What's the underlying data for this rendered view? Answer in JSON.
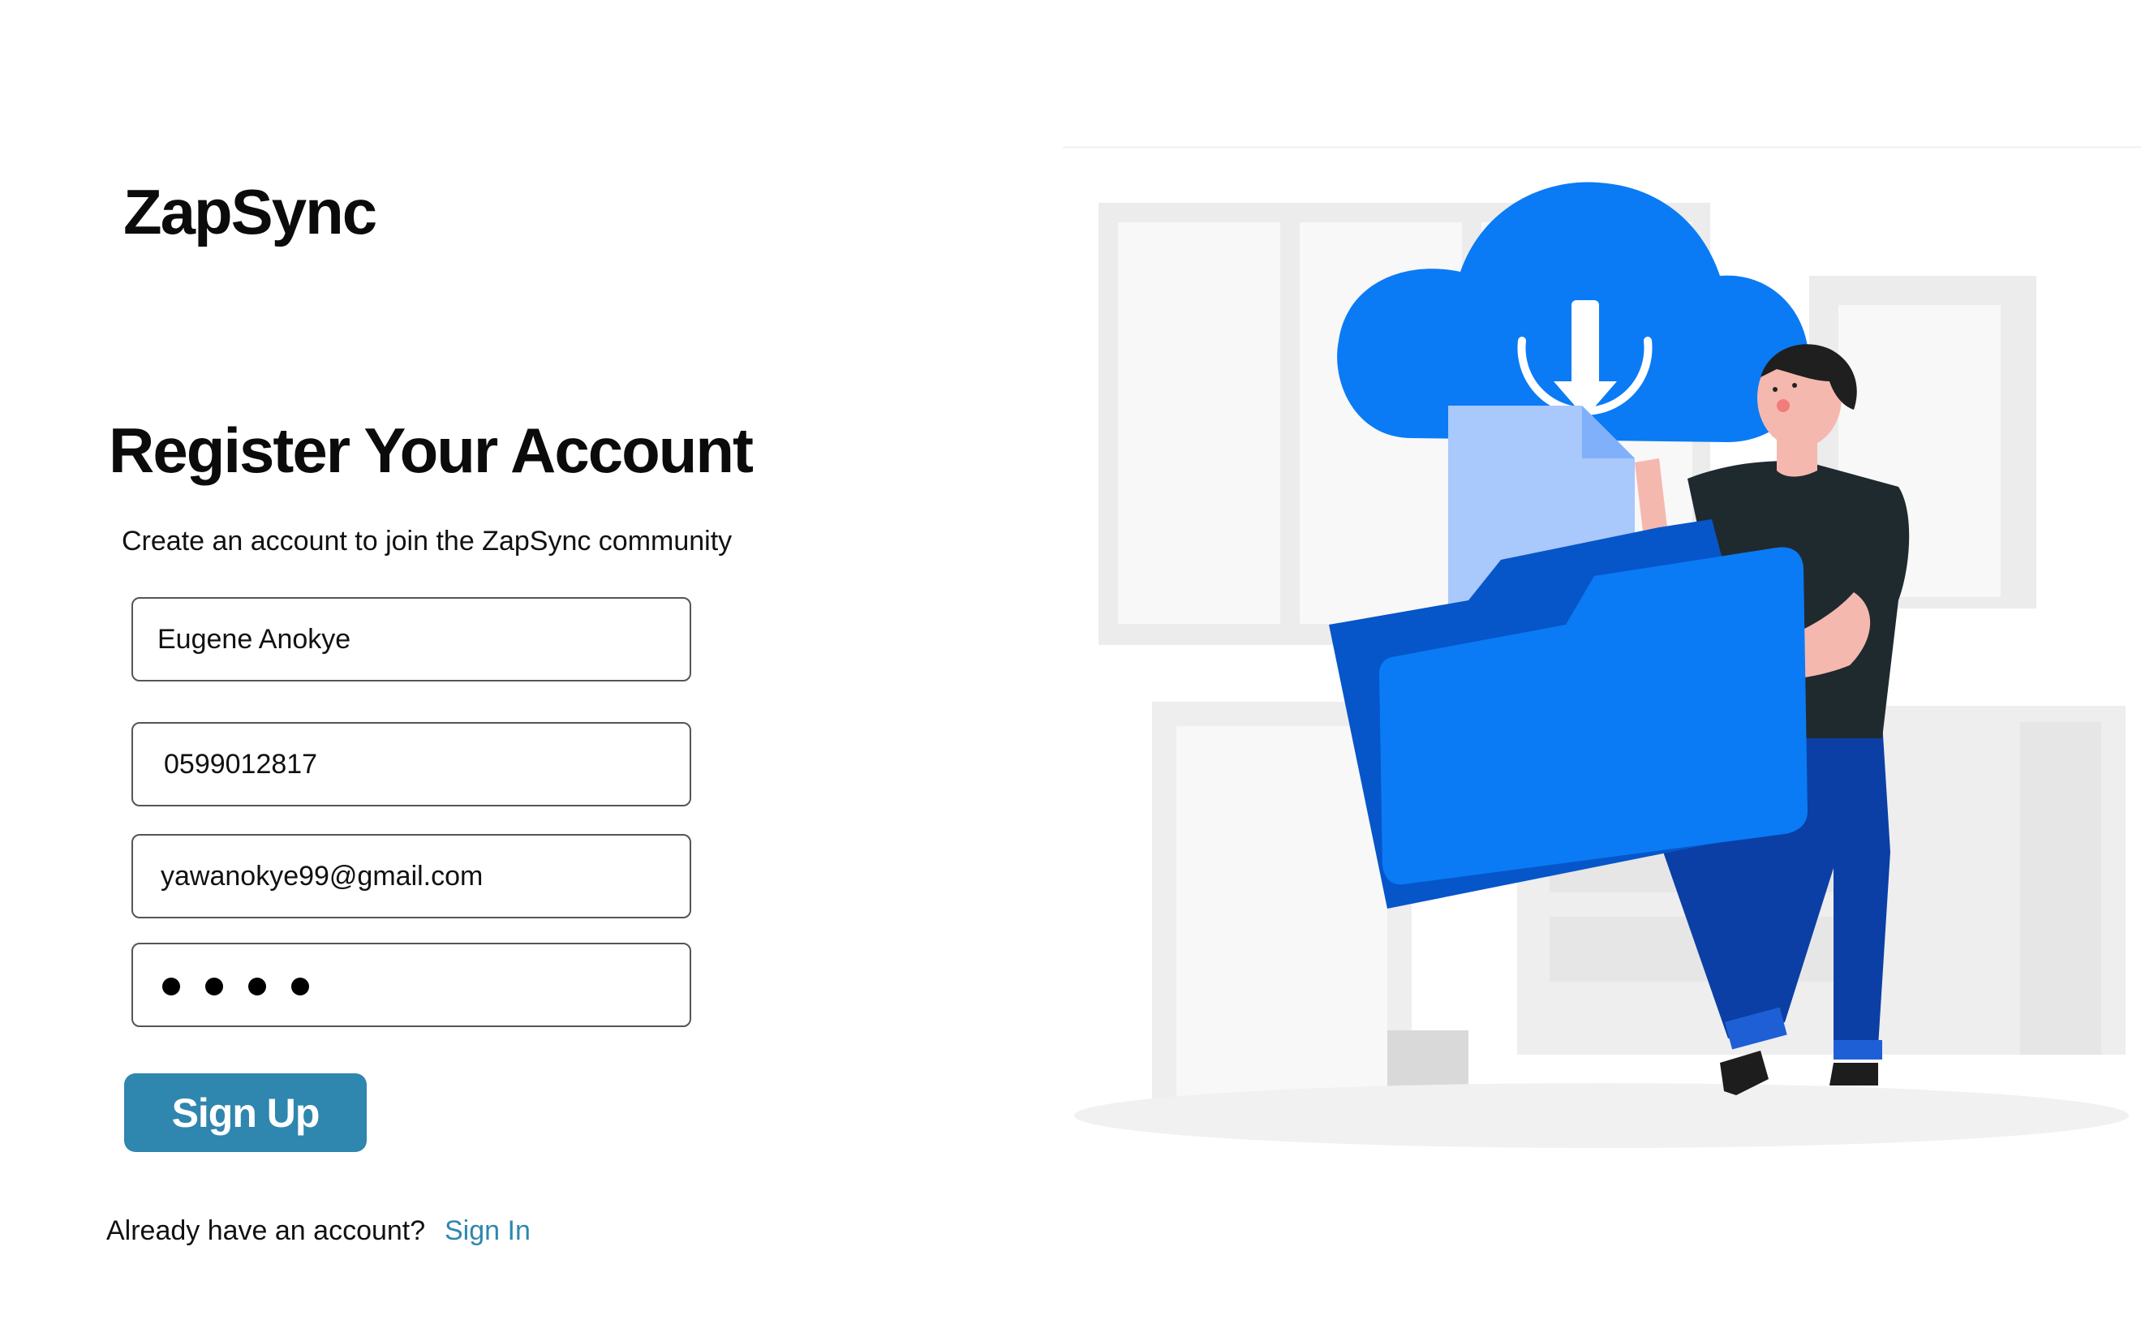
{
  "brand": {
    "name": "ZapSync"
  },
  "form": {
    "title": "Register Your Account",
    "subtitle": "Create an account to join the ZapSync community",
    "fields": {
      "name": {
        "value": "Eugene Anokye"
      },
      "phone": {
        "value": "0599012817"
      },
      "email": {
        "value": "yawanokye99@gmail.com"
      },
      "password": {
        "value": "••••",
        "masked_length": 4
      }
    },
    "submit_label": "Sign Up"
  },
  "footer": {
    "prompt": "Already have an account?",
    "link_label": "Sign In"
  },
  "colors": {
    "accent": "#2f86ae",
    "cloud_blue": "#0a7bf5",
    "folder_dark": "#0656c9",
    "document_light": "#a9c8fb",
    "pants": "#0b3fa6",
    "shirt": "#1f2a2f"
  },
  "illustration": {
    "icons": [
      "cloud-download-icon",
      "folder-icon",
      "document-icon"
    ]
  }
}
